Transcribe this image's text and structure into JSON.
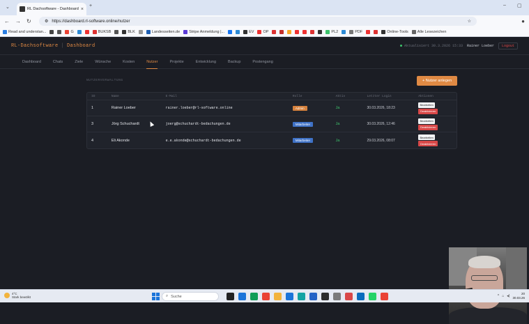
{
  "browser": {
    "tab_title": "RL Dachsoftware - Dashboard",
    "url": "https://dashboard.rl-software.online/nutzer",
    "bookmarks": [
      "Read and understan...",
      "",
      "",
      "G",
      "",
      "",
      "BUKSB",
      "",
      "BLK",
      "",
      "Landesseiten.de",
      "Stripe Anmeldung |...",
      "",
      "",
      "EV",
      "OP",
      "",
      "",
      "",
      "",
      "",
      "",
      "",
      "PL2",
      "",
      "PDF",
      "",
      "",
      "Online-Tools",
      "Alle Lesezeichen"
    ],
    "bookmark_colors": [
      "#2a7de1",
      "#444",
      "#555",
      "#ea4335",
      "#2d8bd6",
      "#e33",
      "#d33",
      "#555",
      "#333",
      "#999",
      "#1e5fb3",
      "#5c3bd6",
      "#1877f2",
      "#2d8bd6",
      "#333",
      "#e33",
      "#d33",
      "#c4302b",
      "#f9a825",
      "#e33",
      "#e33",
      "#d33",
      "#333",
      "#3ec46d",
      "#2d8bd6",
      "#777",
      "#e33",
      "#d33",
      "#333",
      "#666"
    ]
  },
  "app": {
    "brand": "RL-Dachsoftware",
    "section": "Dashboard",
    "status": "Aktualisiert 30.3.2026 15:33",
    "user": "Rainer Loeber",
    "logout": "Logout"
  },
  "nav": [
    "Dashboard",
    "Chats",
    "Ziele",
    "Wünsche",
    "Kosten",
    "Nutzer",
    "Projekte",
    "Entwicklung",
    "Backup",
    "Postengang"
  ],
  "nav_active": "Nutzer",
  "page": {
    "section_label": "NUTZERVERWALTUNG",
    "add_button": "+ Nutzer anlegen"
  },
  "table": {
    "headers": [
      "ID",
      "Name",
      "E-Mail",
      "Rolle",
      "Aktiv",
      "Letzter Login",
      "Aktionen"
    ],
    "rows": [
      {
        "id": "1",
        "name": "Rainer Loeber",
        "email": "rainer.loeber@rl-software.online",
        "role": "Admin",
        "role_type": "admin",
        "active": "Ja",
        "last_login": "30.03.2026, 18:23",
        "edit": "Bearbeiten",
        "deactivate": "Deaktivieren"
      },
      {
        "id": "3",
        "name": "Jörg Schuchardt",
        "email": "joerg@schuchardt-bedachungen.de",
        "role": "Mitarbeiter",
        "role_type": "mit",
        "active": "Ja",
        "last_login": "30.03.2026, 12:46",
        "edit": "Bearbeiten",
        "deactivate": "Deaktivieren"
      },
      {
        "id": "4",
        "name": "Eli Akonde",
        "email": "e.e.akonde@schuchardt-bedachungen.de",
        "role": "Mitarbeiter",
        "role_type": "mit",
        "active": "Ja",
        "last_login": "29.03.2026, 08:07",
        "edit": "Bearbeiten",
        "deactivate": "Deaktivieren"
      }
    ]
  },
  "taskbar": {
    "weather_temp": "4°C",
    "weather_desc": "Stark bewölkt",
    "search_placeholder": "Suche",
    "time": "20",
    "date": "30.03.26",
    "icon_colors": [
      "#222",
      "#1b74d9",
      "#0f9d58",
      "#ea4335",
      "#f2b33d",
      "#1b74d9",
      "#14a3a3",
      "#2463c6",
      "#2d2d2d",
      "#7b7b7b",
      "#d94848",
      "#0b6cbd",
      "#25d366",
      "#ea4335"
    ]
  }
}
